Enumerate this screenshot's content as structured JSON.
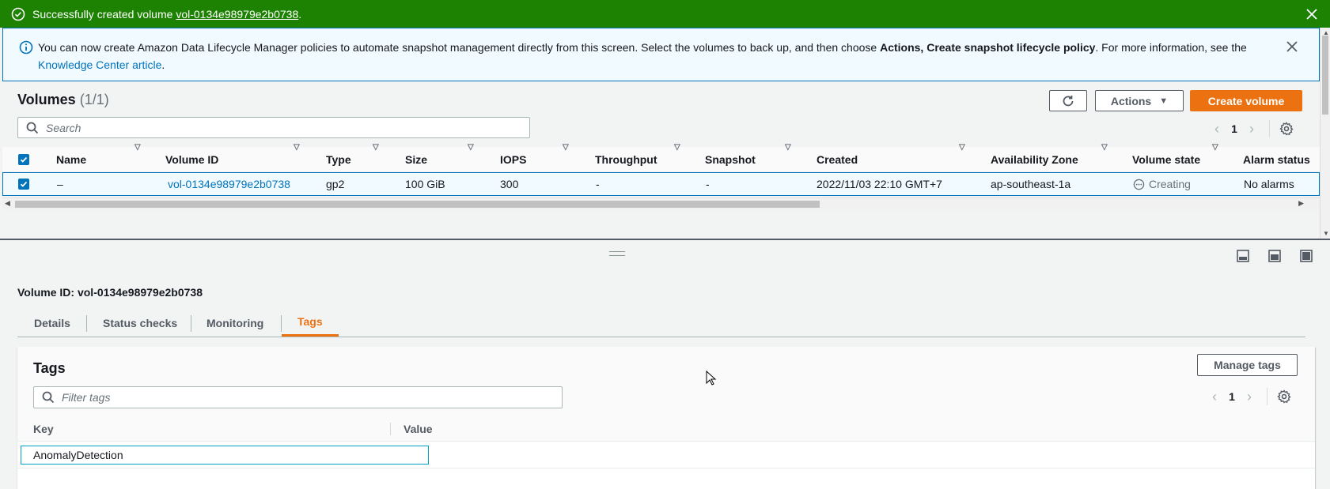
{
  "flash_success": {
    "prefix": "Successfully created volume ",
    "volume_link": "vol-0134e98979e2b0738",
    "suffix": "."
  },
  "flash_info": {
    "text_before": "You can now create Amazon Data Lifecycle Manager policies to automate snapshot management directly from this screen. Select the volumes to back up, and then choose ",
    "bold": "Actions, Create snapshot lifecycle policy",
    "text_after": ". For more information, see the ",
    "link": "Knowledge Center article",
    "end": "."
  },
  "volumes": {
    "title": "Volumes",
    "count": "(1/1)",
    "refresh_icon": "refresh-icon",
    "actions_label": "Actions",
    "create_label": "Create volume",
    "search_placeholder": "Search",
    "page": "1",
    "columns": [
      "Name",
      "Volume ID",
      "Type",
      "Size",
      "IOPS",
      "Throughput",
      "Snapshot",
      "Created",
      "Availability Zone",
      "Volume state",
      "Alarm status"
    ],
    "rows": [
      {
        "name": "–",
        "volume_id": "vol-0134e98979e2b0738",
        "type": "gp2",
        "size": "100 GiB",
        "iops": "300",
        "throughput": "-",
        "snapshot": "-",
        "created": "2022/11/03 22:10 GMT+7",
        "az": "ap-southeast-1a",
        "state": "Creating",
        "alarm": "No alarms"
      }
    ]
  },
  "detail": {
    "title": "Volume ID: vol-0134e98979e2b0738",
    "tabs": [
      "Details",
      "Status checks",
      "Monitoring",
      "Tags"
    ],
    "active_tab": "Tags"
  },
  "tags": {
    "title": "Tags",
    "manage_label": "Manage tags",
    "filter_placeholder": "Filter tags",
    "page": "1",
    "col_key": "Key",
    "col_value": "Value",
    "rows": [
      {
        "key": "AnomalyDetection",
        "value": ""
      }
    ]
  },
  "colors": {
    "success": "#1d8102",
    "info_border": "#0073bb",
    "primary": "#ec7211",
    "link": "#0073bb"
  }
}
